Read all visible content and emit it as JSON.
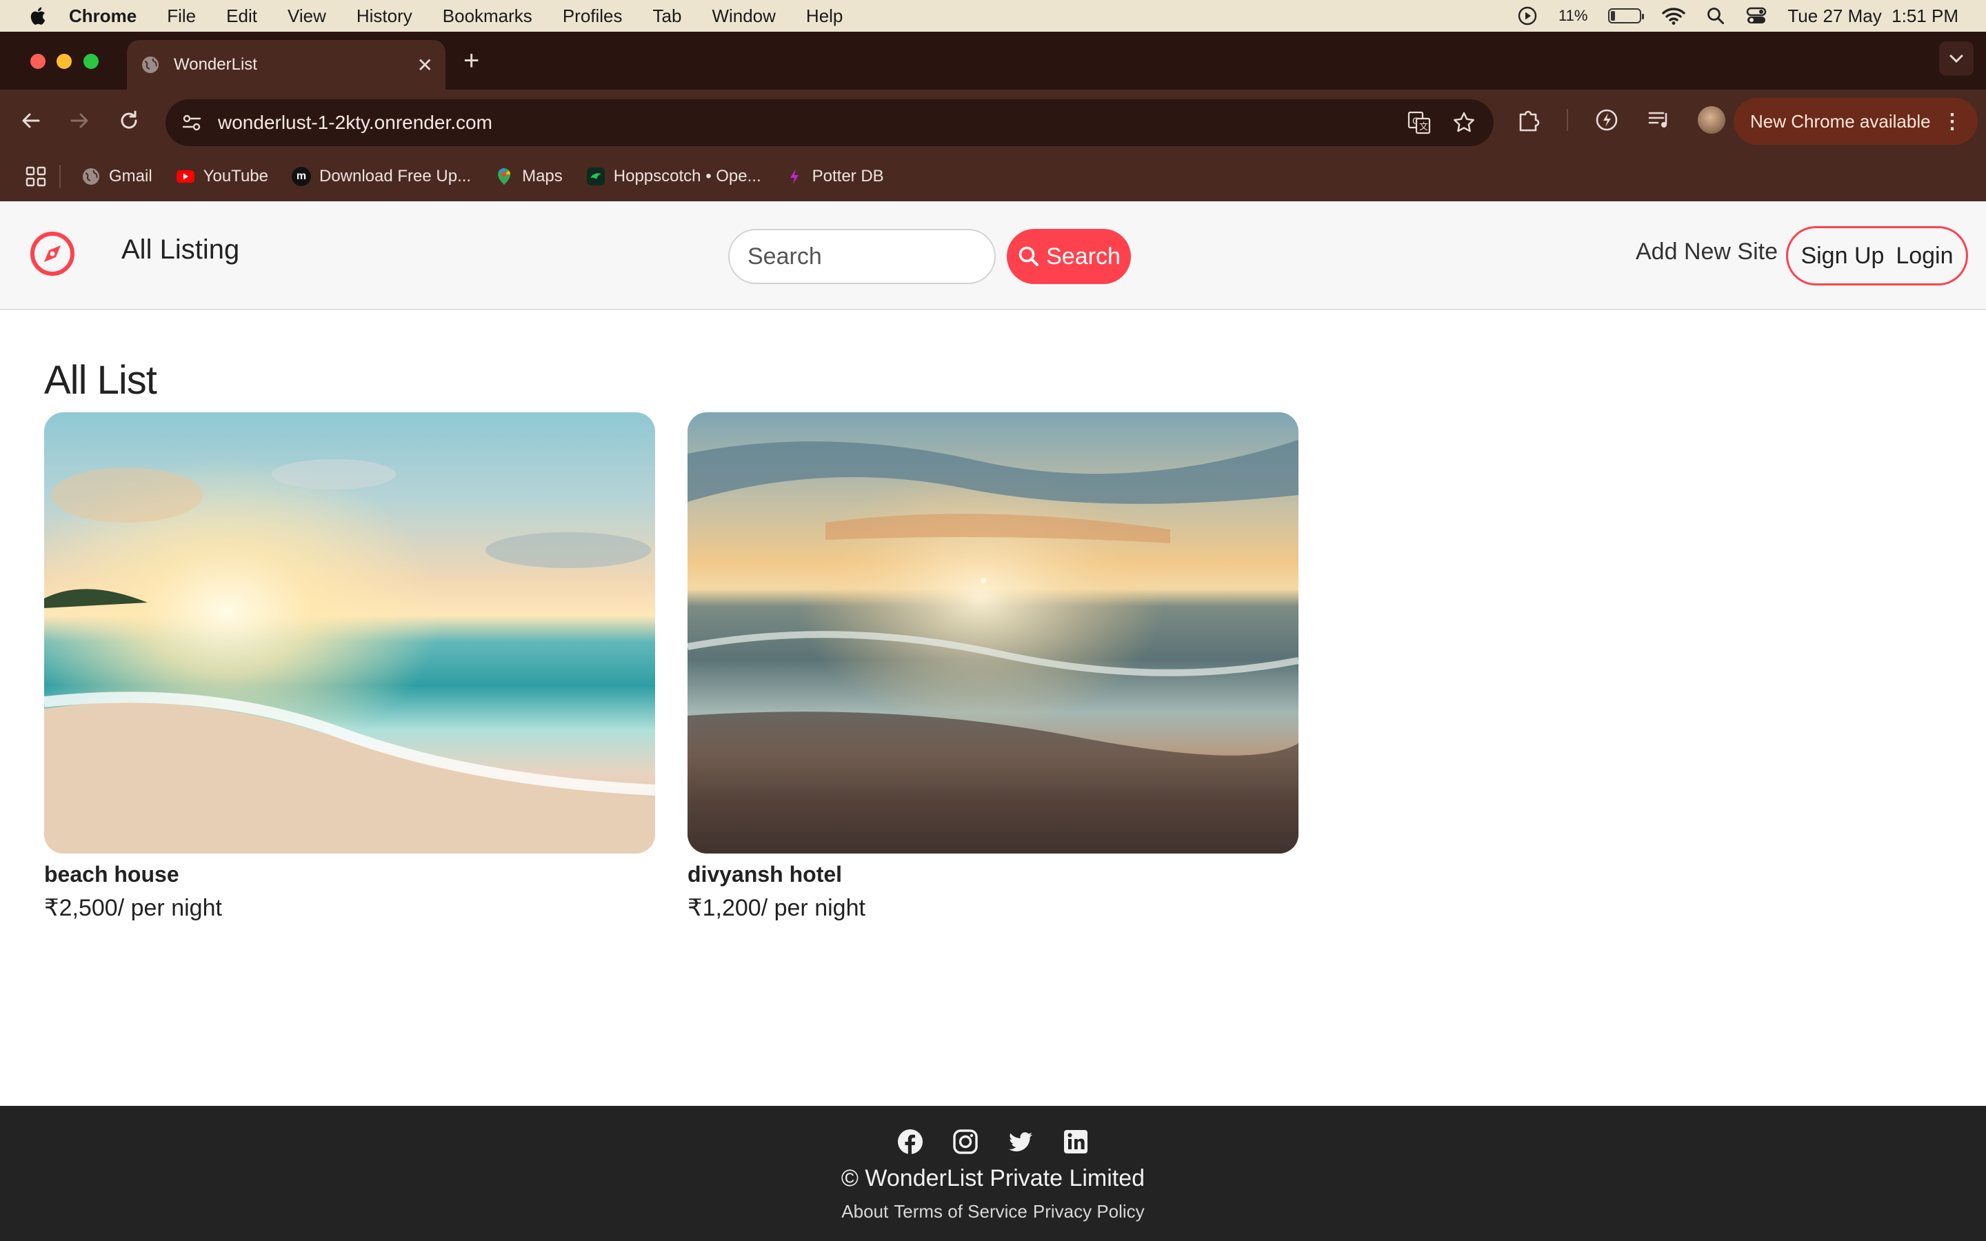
{
  "menubar": {
    "app": "Chrome",
    "items": [
      "File",
      "Edit",
      "View",
      "History",
      "Bookmarks",
      "Profiles",
      "Tab",
      "Window",
      "Help"
    ],
    "battery_pct": "11%",
    "datetime": "Tue 27 May  1:51 PM"
  },
  "browser": {
    "tab_title": "WonderList",
    "url": "wonderlust-1-2kty.onrender.com",
    "update_label": "New Chrome available",
    "bookmarks": [
      {
        "label": "Gmail",
        "icon": "globe-icon"
      },
      {
        "label": "YouTube",
        "icon": "youtube-icon"
      },
      {
        "label": "Download Free Up...",
        "icon": "m-icon"
      },
      {
        "label": "Maps",
        "icon": "maps-icon"
      },
      {
        "label": "Hoppscotch • Ope...",
        "icon": "hoppscotch-icon"
      },
      {
        "label": "Potter DB",
        "icon": "bolt-icon"
      }
    ]
  },
  "nav": {
    "title": "All Listing",
    "search_placeholder": "Search",
    "search_button": "Search",
    "add_new": "Add New Site",
    "signup": "Sign Up",
    "login": "Login",
    "accent": "#fe424d"
  },
  "main": {
    "heading": "All List",
    "listings": [
      {
        "name": "beach house",
        "price": "₹2,500/ per night"
      },
      {
        "name": "divyansh hotel",
        "price": "₹1,200/ per night"
      }
    ]
  },
  "footer": {
    "socials": [
      "facebook-icon",
      "instagram-icon",
      "twitter-icon",
      "linkedin-icon"
    ],
    "copyright": "© WonderList Private Limited",
    "links": [
      "About",
      "Terms of Service",
      "Privacy Policy"
    ]
  }
}
